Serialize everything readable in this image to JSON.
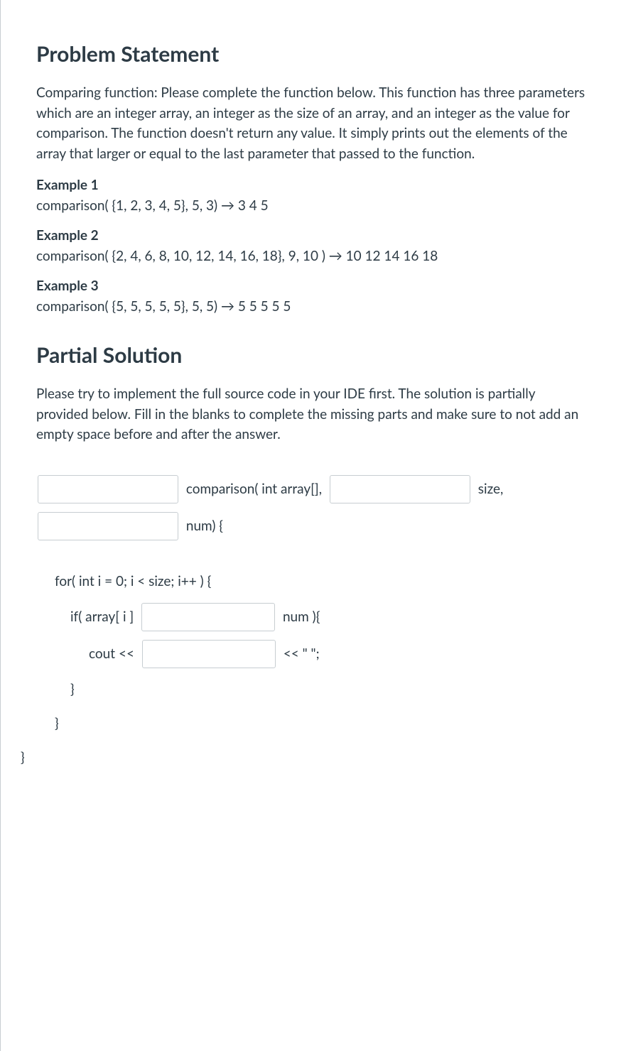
{
  "headings": {
    "problem": "Problem Statement",
    "partial": "Partial Solution"
  },
  "problem_desc": "Comparing function: Please complete the function below. This function has three parameters which are an integer array, an integer as the size of an array, and an integer as the value for comparison. The function doesn't return any value. It simply prints out the elements of the array that larger or equal to the last parameter that passed to the function.",
  "examples": [
    {
      "label": "Example 1",
      "text": " comparison( {1, 2, 3, 4, 5}, 5, 3) → 3 4 5"
    },
    {
      "label": "Example 2",
      "text": "comparison( {2, 4, 6, 8, 10, 12, 14, 16, 18}, 9, 10 ) → 10 12 14 16 18"
    },
    {
      "label": "Example 3",
      "text": "comparison( {5, 5, 5, 5, 5}, 5, 5) → 5 5 5 5 5"
    }
  ],
  "partial_desc": "Please try to implement the full source code in your IDE first. The solution is partially provided below. Fill in the blanks to complete the missing parts and make sure to not add an empty space before and after the answer.",
  "code": {
    "line1_a": " comparison( int array[], ",
    "line1_b": " size,",
    "line2_a": " num) {",
    "line3": "for( int i = 0; i < size; i++ ) {",
    "line4_a": "if( array[ i ] ",
    "line4_b": " num ){",
    "line5_a": "cout << ",
    "line5_b": " << \" \";",
    "line6": "}",
    "line7": "}",
    "line8": "}"
  }
}
